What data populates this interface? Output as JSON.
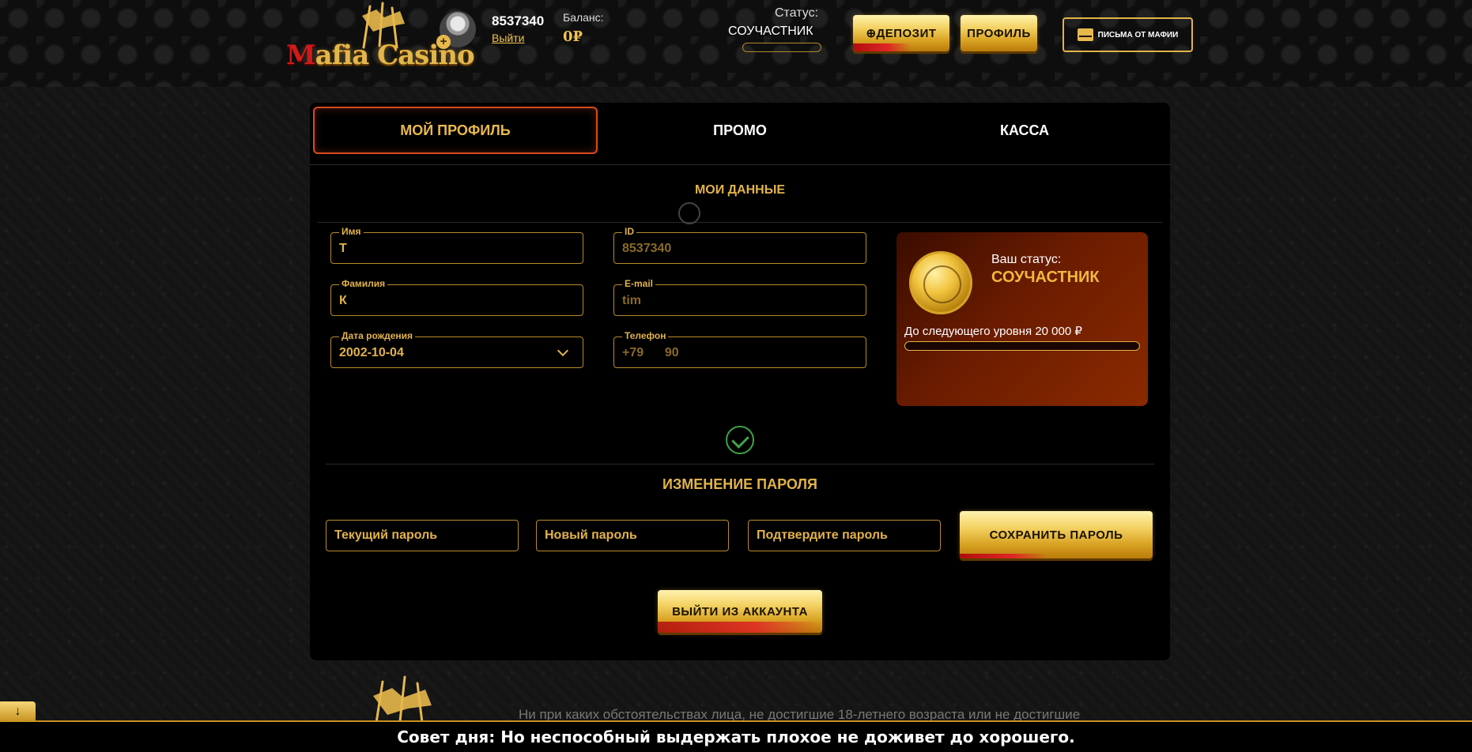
{
  "header": {
    "logo_text_red": "M",
    "logo_text_rest": "afia Casino",
    "user_id": "8537340",
    "logout_link": "Выйти",
    "balance_label": "Баланс:",
    "balance_value": "0₽",
    "status_label": "Статус:",
    "status_value": "СОУЧАСТНИК",
    "deposit_label": "ДЕПОЗИТ",
    "profile_label": "ПРОФИЛЬ",
    "letters_label": "ПИСЬМА ОТ МАФИИ"
  },
  "tabs": [
    {
      "label": "МОЙ ПРОФИЛЬ",
      "active": true
    },
    {
      "label": "ПРОМО",
      "active": false
    },
    {
      "label": "КАССА",
      "active": false
    }
  ],
  "my_data": {
    "title": "МОИ ДАННЫЕ",
    "fields": {
      "first_name": {
        "label": "Имя",
        "value": "Т"
      },
      "id": {
        "label": "ID",
        "value": "8537340"
      },
      "last_name": {
        "label": "Фамилия",
        "value": "К"
      },
      "email": {
        "label": "E-mail",
        "value": "tim"
      },
      "birth_date": {
        "label": "Дата рождения",
        "value": "2002-10-04"
      },
      "phone": {
        "label": "Телефон",
        "value": "+79      90"
      }
    }
  },
  "status_card": {
    "label": "Ваш статус:",
    "status": "СОУЧАСТНИК",
    "next_level": "До следующего уровня 20 000 ₽",
    "progress": 0
  },
  "password": {
    "title": "ИЗМЕНЕНИЕ ПАРОЛЯ",
    "current_placeholder": "Текущий пароль",
    "new_placeholder": "Новый пароль",
    "confirm_placeholder": "Подтвердите пароль",
    "save_label": "СОХРАНИТЬ ПАРОЛЬ"
  },
  "logout_button": "ВЫЙТИ ИЗ АККАУНТА",
  "footer": {
    "disclaimer": "Ни при каких обстоятельствах лица, не достигшие 18-летнего возраста или не достигшие",
    "tip": "Совет дня: Но неспособный выдержать плохое не доживет до хорошего.",
    "scroll_icon": "↓"
  },
  "colors": {
    "gold": "#e2b34a",
    "accent_red": "#d94a1f",
    "success": "#3ea34a"
  }
}
